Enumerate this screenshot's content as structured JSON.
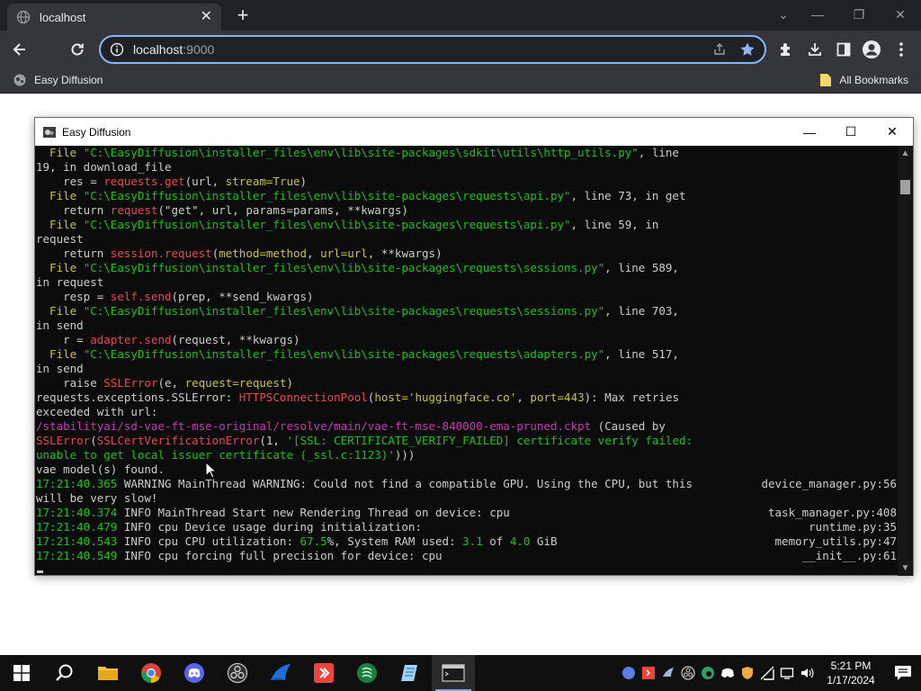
{
  "browser": {
    "tab_title": "localhost",
    "url_host": "localhost",
    "url_port": ":9000",
    "bookmark_label": "Easy Diffusion",
    "all_bookmarks_label": "All Bookmarks"
  },
  "console": {
    "title": "Easy Diffusion",
    "lines": [
      [
        [
          "y",
          "  File "
        ],
        [
          "g",
          "\"C:\\EasyDiffusion\\installer_files\\env\\lib\\site-packages\\sdkit\\utils\\http_utils.py\""
        ],
        [
          "w",
          ", line"
        ]
      ],
      [
        [
          "w",
          "19, in download_file"
        ]
      ],
      [
        [
          "w",
          "    res = "
        ],
        [
          "r",
          "requests.get"
        ],
        [
          "w",
          "(url, "
        ],
        [
          "y",
          "stream=True"
        ],
        [
          "w",
          ")"
        ]
      ],
      [
        [
          "y",
          "  File "
        ],
        [
          "g",
          "\"C:\\EasyDiffusion\\installer_files\\env\\lib\\site-packages\\requests\\api.py\""
        ],
        [
          "w",
          ", line 73, in get"
        ]
      ],
      [
        [
          "w",
          "    return "
        ],
        [
          "r",
          "request"
        ],
        [
          "w",
          "(\"get\", url, params=params, **kwargs)"
        ]
      ],
      [
        [
          "y",
          "  File "
        ],
        [
          "g",
          "\"C:\\EasyDiffusion\\installer_files\\env\\lib\\site-packages\\requests\\api.py\""
        ],
        [
          "w",
          ", line 59, in"
        ]
      ],
      [
        [
          "w",
          "request"
        ]
      ],
      [
        [
          "w",
          "    return "
        ],
        [
          "r",
          "session.request"
        ],
        [
          "w",
          "("
        ],
        [
          "y",
          "method=method"
        ],
        [
          "w",
          ", "
        ],
        [
          "y",
          "url=url"
        ],
        [
          "w",
          ", **kwargs)"
        ]
      ],
      [
        [
          "y",
          "  File "
        ],
        [
          "g",
          "\"C:\\EasyDiffusion\\installer_files\\env\\lib\\site-packages\\requests\\sessions.py\""
        ],
        [
          "w",
          ", line 589,"
        ]
      ],
      [
        [
          "w",
          "in request"
        ]
      ],
      [
        [
          "w",
          "    resp = "
        ],
        [
          "r",
          "self.send"
        ],
        [
          "w",
          "(prep, **send_kwargs)"
        ]
      ],
      [
        [
          "y",
          "  File "
        ],
        [
          "g",
          "\"C:\\EasyDiffusion\\installer_files\\env\\lib\\site-packages\\requests\\sessions.py\""
        ],
        [
          "w",
          ", line 703,"
        ]
      ],
      [
        [
          "w",
          "in send"
        ]
      ],
      [
        [
          "w",
          "    r = "
        ],
        [
          "r",
          "adapter.send"
        ],
        [
          "w",
          "(request, **kwargs)"
        ]
      ],
      [
        [
          "y",
          "  File "
        ],
        [
          "g",
          "\"C:\\EasyDiffusion\\installer_files\\env\\lib\\site-packages\\requests\\adapters.py\""
        ],
        [
          "w",
          ", line 517,"
        ]
      ],
      [
        [
          "w",
          "in send"
        ]
      ],
      [
        [
          "w",
          "    raise "
        ],
        [
          "r",
          "SSLError"
        ],
        [
          "w",
          "(e, "
        ],
        [
          "y",
          "request=request"
        ],
        [
          "w",
          ")"
        ]
      ],
      [
        [
          "w",
          "requests.exceptions.SSLError: "
        ],
        [
          "r",
          "HTTPSConnectionPool"
        ],
        [
          "w",
          "("
        ],
        [
          "y",
          "host='huggingface.co'"
        ],
        [
          "w",
          ", "
        ],
        [
          "y",
          "port=443"
        ],
        [
          "w",
          "): Max retries"
        ]
      ],
      [
        [
          "w",
          "exceeded with url:"
        ]
      ],
      [
        [
          "m",
          "/stabilityai/sd-vae-ft-mse-original/resolve/main/vae-ft-mse-840000-ema-pruned.ckpt"
        ],
        [
          "w",
          " (Caused by"
        ]
      ],
      [
        [
          "r",
          "SSLError"
        ],
        [
          "w",
          "("
        ],
        [
          "r",
          "SSLCertVerificationError"
        ],
        [
          "w",
          "(1, "
        ],
        [
          "g",
          "'[SSL: CERTIFICATE_VERIFY_FAILED] certificate verify failed:"
        ]
      ],
      [
        [
          "g",
          "unable to get local issuer certificate (_ssl.c:1123)'"
        ],
        [
          "w",
          ")))"
        ]
      ],
      [
        [
          "w",
          "vae model(s) found."
        ]
      ],
      [
        [
          "g",
          "17:21:40.365"
        ],
        [
          "w",
          " WARNING MainThread WARNING: Could not find a compatible GPU. Using the CPU, but this"
        ]
      ],
      [
        [
          "w",
          "will be very slow!"
        ]
      ],
      [
        [
          "g",
          "17:21:40.374"
        ],
        [
          "w",
          " INFO MainThread Start new Rendering Thread on device: cpu"
        ]
      ],
      [
        [
          "g",
          "17:21:40.479"
        ],
        [
          "w",
          " INFO cpu Device usage during initialization:"
        ]
      ],
      [
        [
          "g",
          "17:21:40.543"
        ],
        [
          "w",
          " INFO cpu CPU utilization: "
        ],
        [
          "g",
          "67.5"
        ],
        [
          "w",
          "%, System RAM used: "
        ],
        [
          "g",
          "3.1"
        ],
        [
          "w",
          " of "
        ],
        [
          "g",
          "4.0"
        ],
        [
          "w",
          " GiB"
        ]
      ],
      [
        [
          "g",
          "17:21:40.549"
        ],
        [
          "w",
          " INFO cpu forcing full precision for device: cpu"
        ]
      ]
    ],
    "right_labels": [
      "",
      "",
      "",
      "",
      "",
      "",
      "",
      "",
      "",
      "",
      "",
      "",
      "",
      "",
      "",
      "",
      "",
      "",
      "",
      "",
      "",
      "",
      "",
      "device_manager.py:56",
      "",
      "task_manager.py:408",
      "runtime.py:35",
      "memory_utils.py:47",
      "__init__.py:61"
    ]
  },
  "taskbar": {
    "time": "5:21 PM",
    "date": "1/17/2024"
  },
  "colors": {
    "chrome_dark": "#202124",
    "chrome_toolbar": "#35363a",
    "omnibox_border": "#8ab4f8",
    "console_bg": "#0c0c0c",
    "console_yellow": "#c4c441",
    "console_green": "#16c60c",
    "console_magenta": "#c239b3",
    "console_red": "#e74856",
    "star_blue": "#8ab4f8"
  }
}
